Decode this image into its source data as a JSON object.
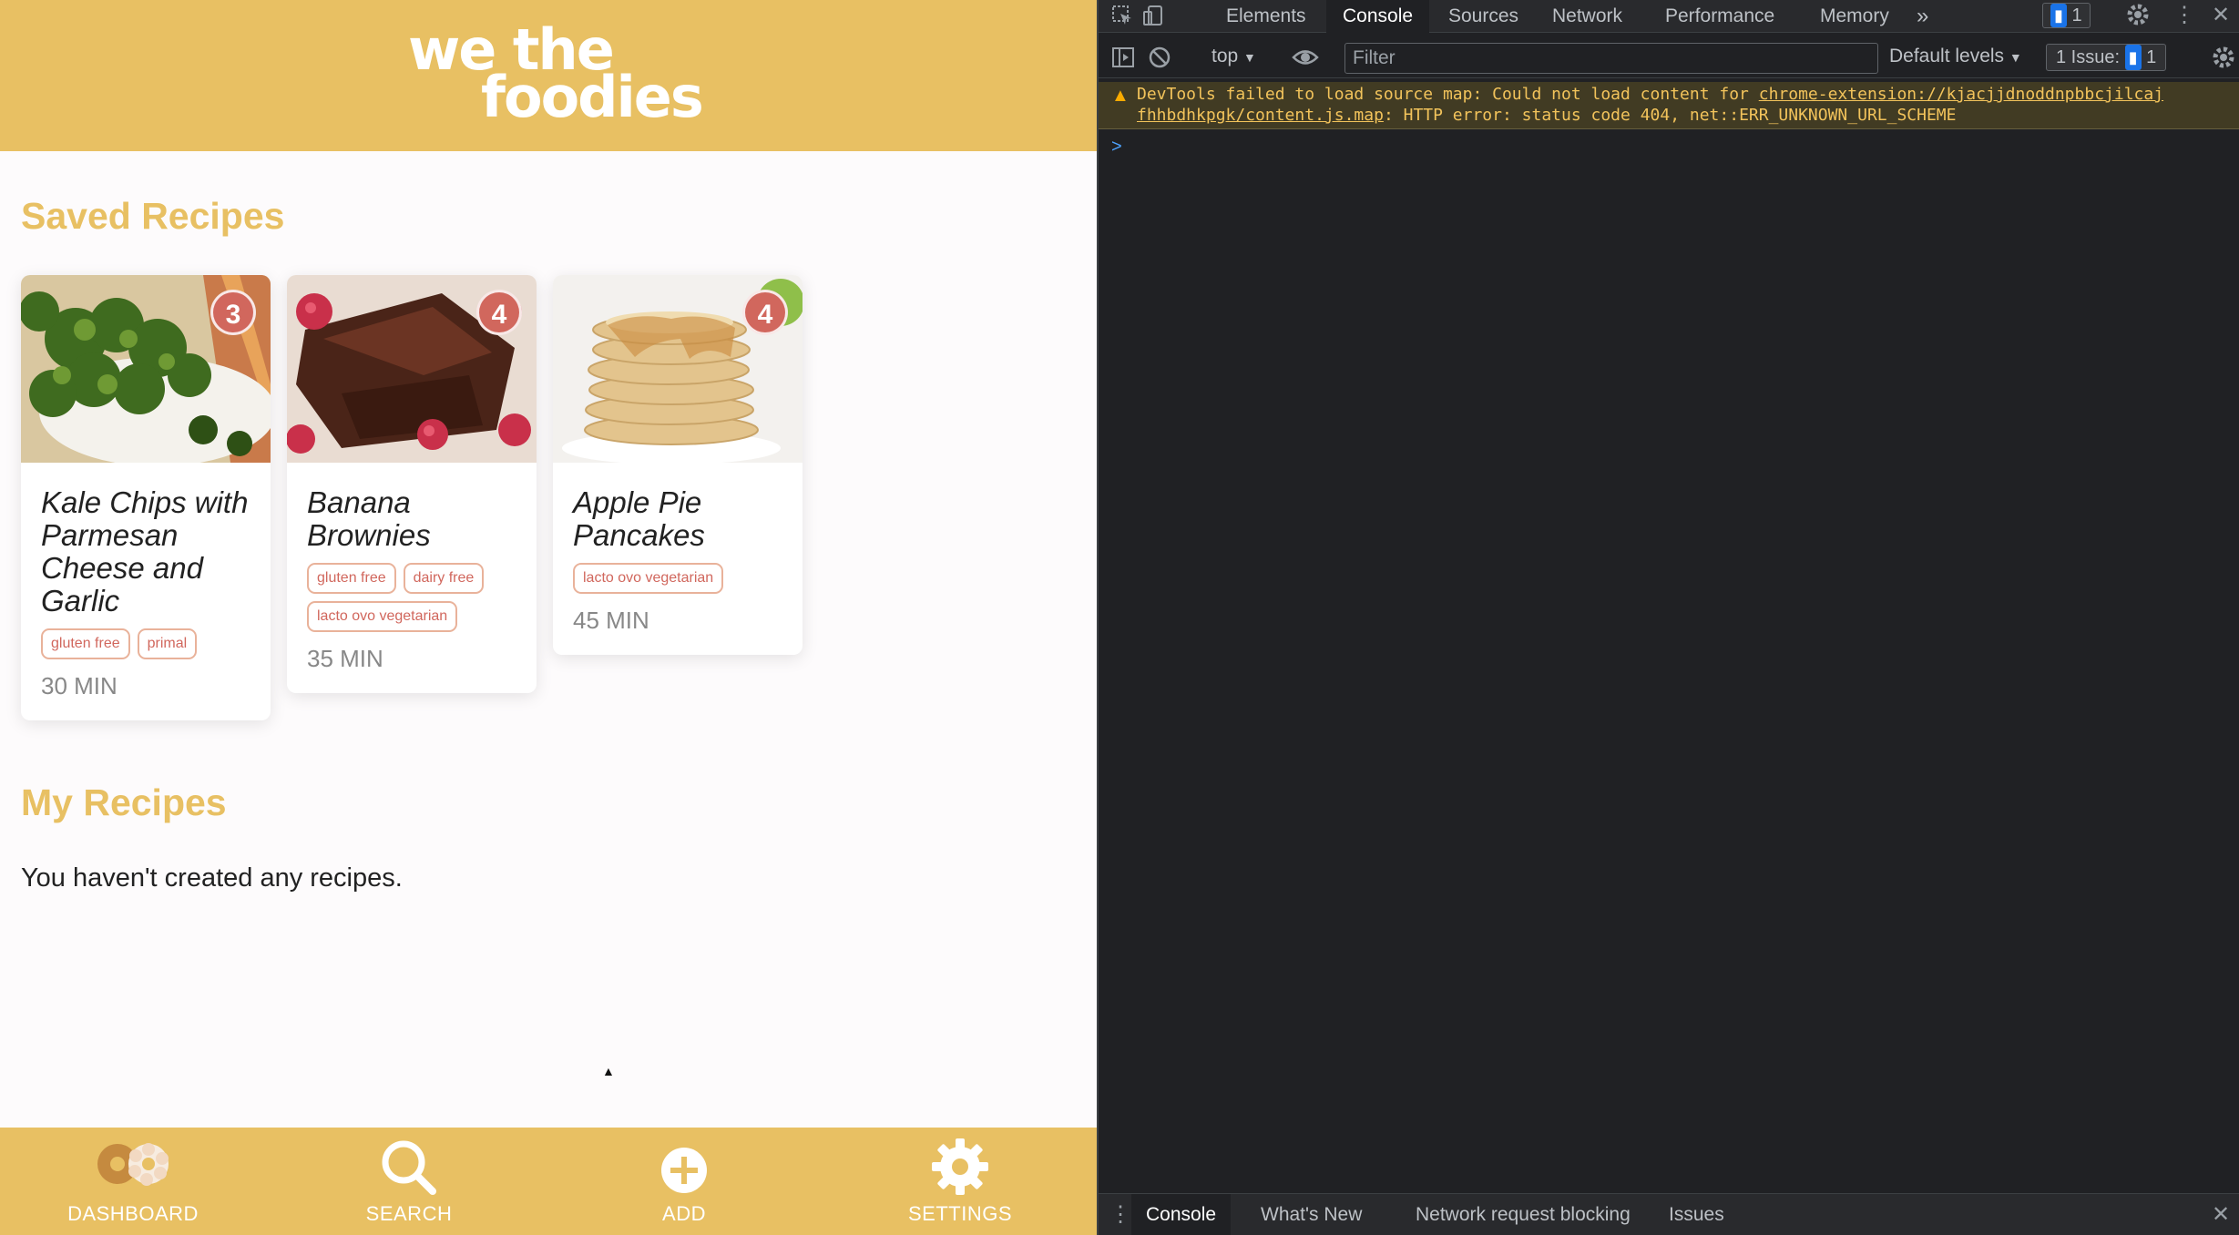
{
  "app": {
    "logo": {
      "line1": "we the",
      "line2": "foodies"
    },
    "saved_title": "Saved Recipes",
    "my_title": "My Recipes",
    "empty_message": "You haven't created any recipes.",
    "cards": [
      {
        "title": "Kale Chips with Parmesan Cheese and Garlic",
        "badge": "3",
        "tags": [
          "gluten free",
          "primal"
        ],
        "time": "30 MIN"
      },
      {
        "title": "Banana Brownies",
        "badge": "4",
        "tags": [
          "gluten free",
          "dairy free",
          "lacto ovo vegetarian"
        ],
        "time": "35 MIN"
      },
      {
        "title": "Apple Pie Pancakes",
        "badge": "4",
        "tags": [
          "lacto ovo vegetarian"
        ],
        "time": "45 MIN"
      }
    ],
    "nav": [
      {
        "label": "DASHBOARD",
        "icon": "donuts-icon"
      },
      {
        "label": "SEARCH",
        "icon": "search-icon"
      },
      {
        "label": "ADD",
        "icon": "add-circle-icon"
      },
      {
        "label": "SETTINGS",
        "icon": "gear-icon"
      }
    ],
    "colors": {
      "brand": "#e8c063",
      "badge": "#d1675d",
      "tag_border": "#e9b29a"
    }
  },
  "devtools": {
    "tabs": [
      "Elements",
      "Console",
      "Sources",
      "Network",
      "Performance",
      "Memory"
    ],
    "active_tab": "Console",
    "more_tabs": "»",
    "message_count": "1",
    "context": "top",
    "filter_placeholder": "Filter",
    "levels": "Default levels",
    "issues_label": "1 Issue:",
    "issues_count": "1",
    "warning": {
      "prefix": "DevTools failed to load source map: Could not load content for ",
      "link_line1": "chrome-extension://kjacjjdnoddnpbbcjilcaj",
      "link_line2": "fhhbdhkpgk/content.js.map",
      "suffix": ": HTTP error: status code 404, net::ERR_UNKNOWN_URL_SCHEME"
    },
    "prompt": ">",
    "drawer_tabs": [
      "Console",
      "What's New",
      "Network request blocking",
      "Issues"
    ],
    "drawer_active": "Console"
  }
}
